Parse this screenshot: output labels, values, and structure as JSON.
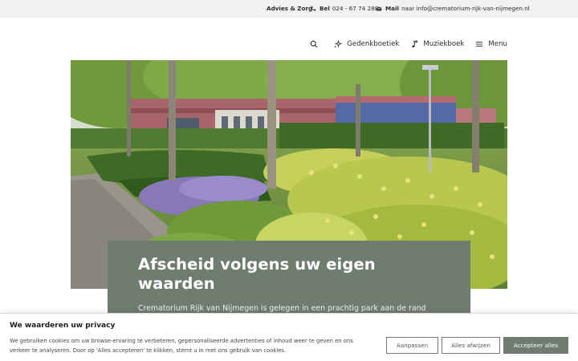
{
  "topbar": {
    "advies_label": "Advies & Zorg",
    "phone_label": "Bel",
    "phone_number": "024 - 67 74 288",
    "mail_label": "Mail",
    "mail_text": "naar info@crematorium-rijk-van-nijmegen.nl"
  },
  "nav": {
    "items": [
      {
        "label": "Gedenkboetiek",
        "icon": "sparkle-icon"
      },
      {
        "label": "Muziekboek",
        "icon": "music-note-icon"
      },
      {
        "label": "Menu",
        "icon": "hamburger-icon"
      }
    ]
  },
  "hero": {
    "title": "Afscheid volgens uw eigen waarden",
    "text": "Crematorium Rijk van Nijmegen is gelegen in een prachtig park aan de rand van Beuningen. Het is een bekende en vertrouwde plek die – tot op de dag van vandaag – voor veel mensen een belangrijke rol speelt rondom het afscheid, om"
  },
  "cookie": {
    "title": "We waarderen uw privacy",
    "text": "We gebruiken cookies om uw browse-ervaring te verbeteren, gepersonaliseerde advertenties of inhoud weer te geven en ons verkeer te analyseren. Door op 'Alles accepteren' te klikken, stemt u in met ons gebruik van cookies.",
    "customize": "Aanpassen",
    "reject": "Alles afwijzen",
    "accept": "Accepteer alles"
  },
  "colors": {
    "accent": "#6f7c70",
    "topbar_bg": "#f1f1f1"
  }
}
